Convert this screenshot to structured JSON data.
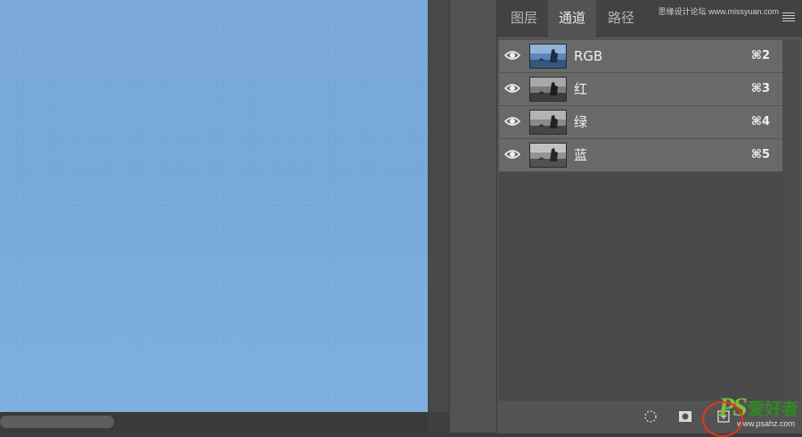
{
  "canvas": {
    "color": "#7aa9d8"
  },
  "panel": {
    "tabs": [
      {
        "label": "图层",
        "active": false
      },
      {
        "label": "通道",
        "active": true
      },
      {
        "label": "路径",
        "active": false
      }
    ],
    "menu_icon": "panel-menu-icon",
    "channels": [
      {
        "name": "RGB",
        "shortcut": "⌘2",
        "visible": true,
        "thumb": "color"
      },
      {
        "name": "红",
        "shortcut": "⌘3",
        "visible": true,
        "thumb": "gray"
      },
      {
        "name": "绿",
        "shortcut": "⌘4",
        "visible": true,
        "thumb": "gray"
      },
      {
        "name": "蓝",
        "shortcut": "⌘5",
        "visible": true,
        "thumb": "gray"
      }
    ],
    "footer_icons": [
      "load-selection-icon",
      "save-selection-icon",
      "new-channel-icon",
      "delete-channel-icon"
    ]
  },
  "watermark": {
    "top_text": "思缘设计论坛 www.missyuan.com",
    "logo_ps": "PS",
    "logo_cn": "爱好者",
    "url": "www.psahz.com"
  },
  "colors": {
    "accent_circle": "#e4361b",
    "active_tab_bg": "#535353"
  }
}
